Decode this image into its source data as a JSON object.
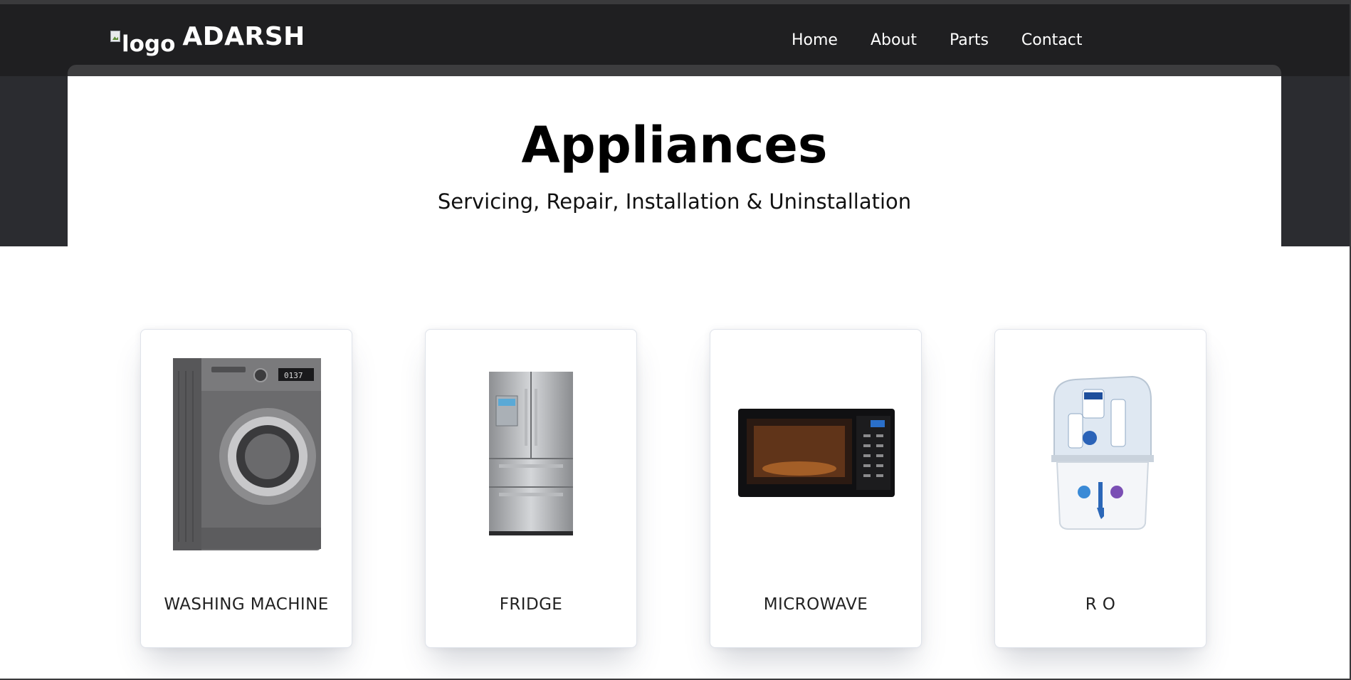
{
  "header": {
    "logo_alt": "logo",
    "brand_name": "ADARSH",
    "nav": [
      {
        "label": "Home"
      },
      {
        "label": "About"
      },
      {
        "label": "Parts"
      },
      {
        "label": "Contact"
      }
    ]
  },
  "hero": {
    "title": "Appliances",
    "subtitle": "Servicing, Repair, Installation & Uninstallation"
  },
  "appliances": [
    {
      "label": "WASHING MACHINE",
      "icon": "washing-machine-image"
    },
    {
      "label": "FRIDGE",
      "icon": "fridge-image"
    },
    {
      "label": "MICROWAVE",
      "icon": "microwave-image"
    },
    {
      "label": "R O",
      "icon": "ro-purifier-image"
    }
  ],
  "colors": {
    "navbar": "#1f1f21",
    "dark_band": "#2b2c30",
    "card_border": "#dfe3ea"
  }
}
